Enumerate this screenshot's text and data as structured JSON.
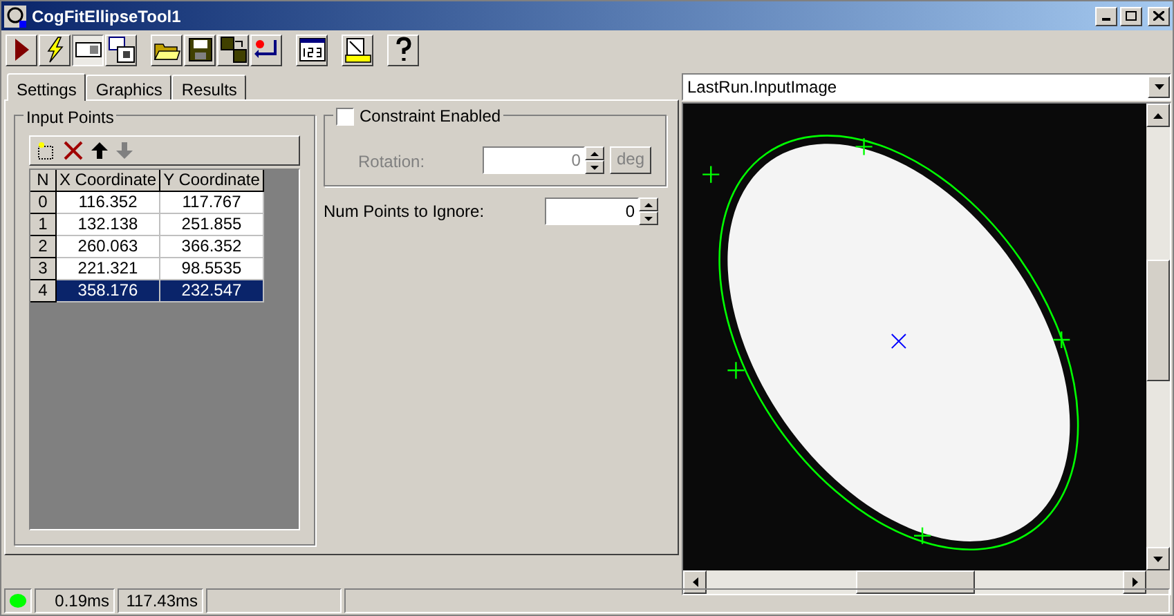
{
  "window": {
    "title": "CogFitEllipseTool1"
  },
  "toolbar": [
    {
      "selected": false
    },
    {
      "selected": false
    },
    {
      "selected": true
    },
    {
      "selected": false
    },
    {
      "selected": false
    },
    {
      "selected": false
    },
    {
      "selected": false
    },
    {
      "selected": false
    },
    {
      "selected": false
    },
    {
      "selected": false
    },
    {
      "selected": false
    }
  ],
  "tabs": [
    {
      "label": "Settings",
      "selected": true
    },
    {
      "label": "Graphics",
      "selected": false
    },
    {
      "label": "Results",
      "selected": false
    }
  ],
  "input_points": {
    "title": "Input Points",
    "columns": [
      "N",
      "X Coordinate",
      "Y Coordinate"
    ],
    "rows": [
      {
        "cells": [
          "0",
          "116.352",
          "117.767"
        ],
        "selected": false
      },
      {
        "cells": [
          "1",
          "132.138",
          "251.855"
        ],
        "selected": false
      },
      {
        "cells": [
          "2",
          "260.063",
          "366.352"
        ],
        "selected": false
      },
      {
        "cells": [
          "3",
          "221.321",
          "98.5535"
        ],
        "selected": false
      },
      {
        "cells": [
          "4",
          "358.176",
          "232.547"
        ],
        "selected": true
      }
    ]
  },
  "constraint": {
    "label": "Constraint Enabled",
    "checked": false,
    "rotation_label": "Rotation:",
    "rotation_value": "0",
    "unit": "deg"
  },
  "num_points": {
    "label": "Num Points to Ignore:",
    "value": "0"
  },
  "image_view": {
    "selector": "LastRun.InputImage"
  },
  "status_bar": {
    "led_on": true,
    "cells": [
      "0.19ms",
      "117.43ms"
    ]
  }
}
